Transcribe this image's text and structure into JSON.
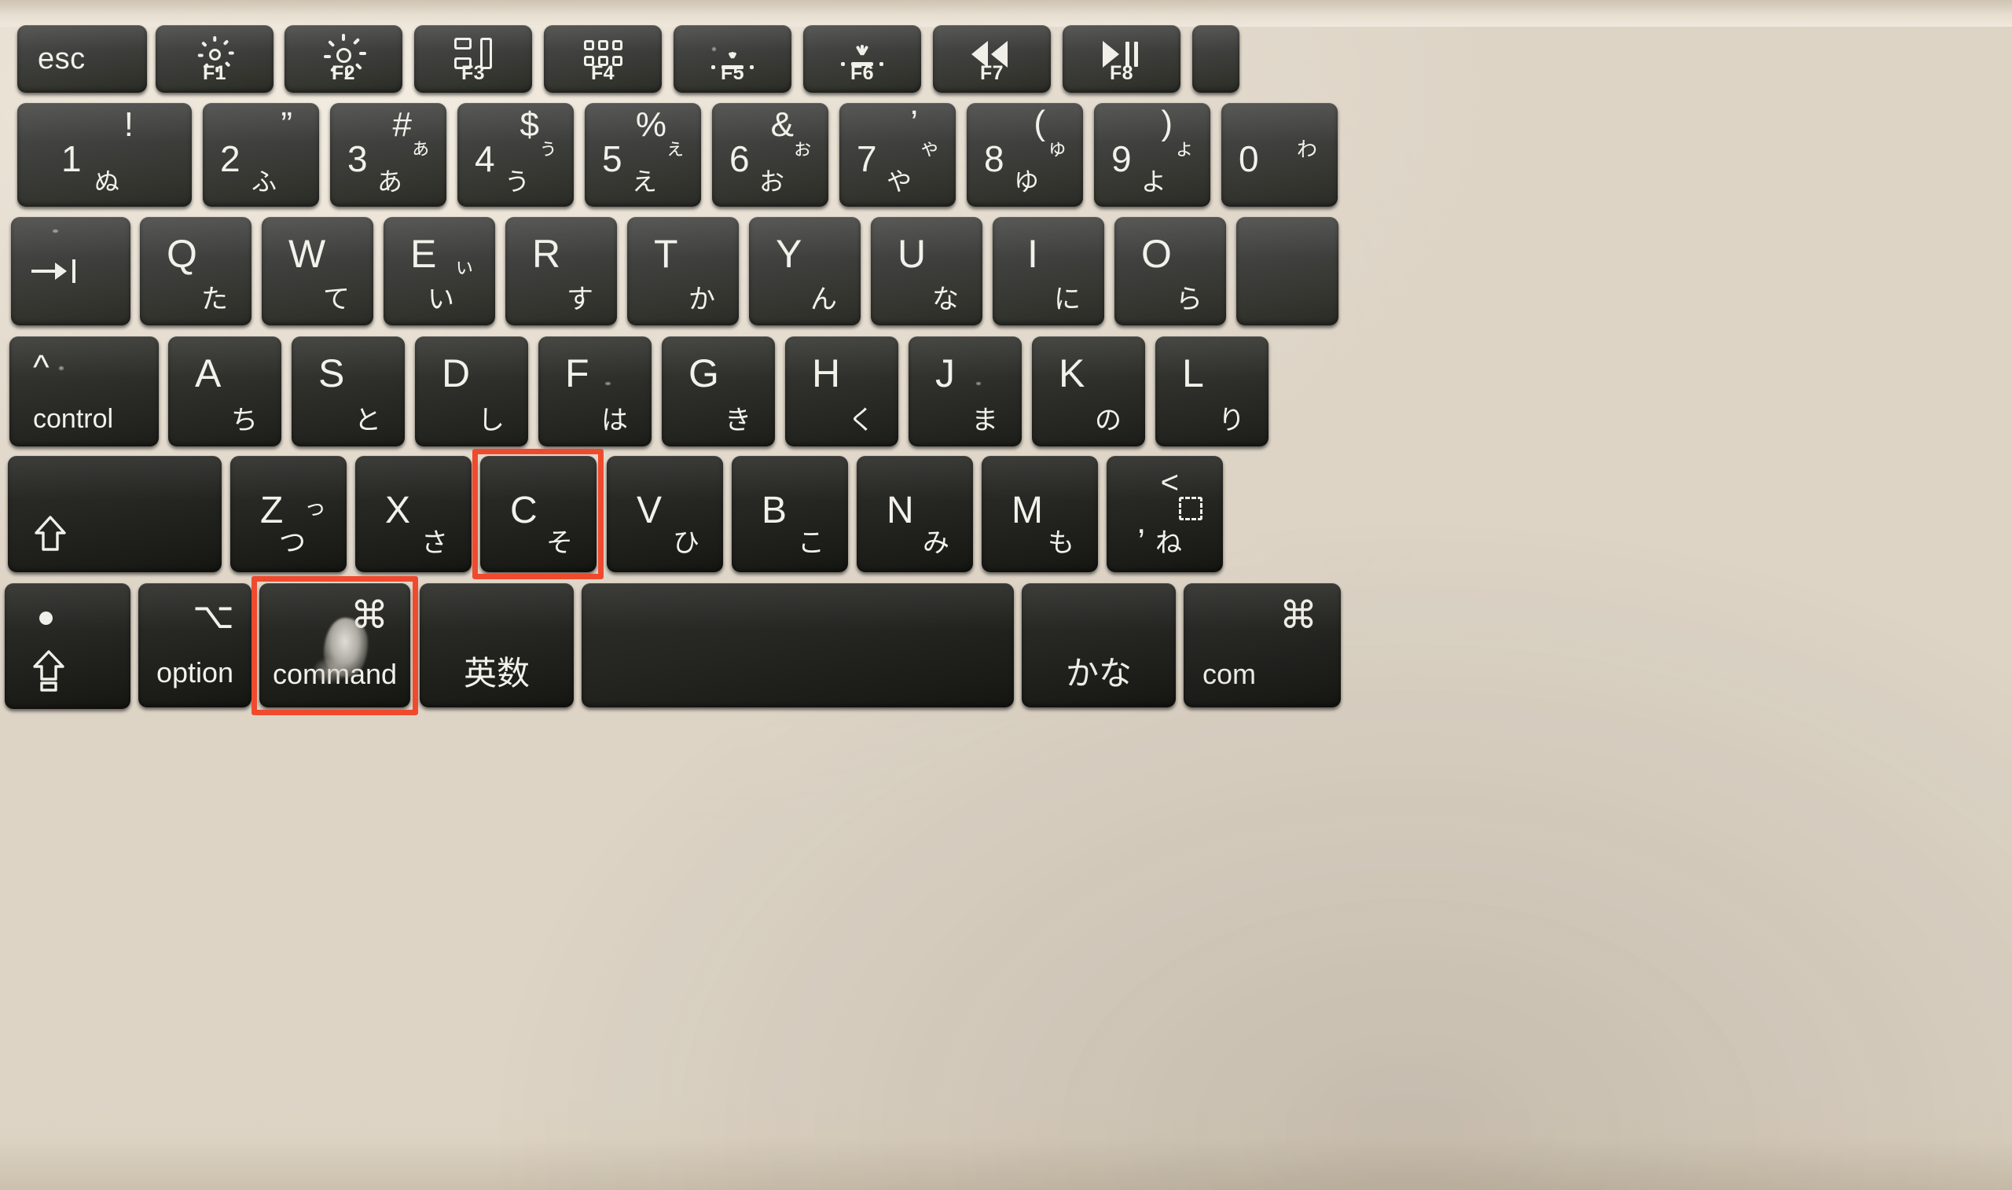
{
  "scene": {
    "subject": "apple-magic-keyboard-japanese-jis-layout",
    "description": "Close-up photograph of a Japanese JIS Apple Magic Keyboard with two keys outlined in red",
    "body_color": "#e4dbcd",
    "key_color": "#3a3b37",
    "legend_color": "#f2f1ea",
    "highlight_color": "#f04a2e"
  },
  "annotations": {
    "highlight_label": "red-outline",
    "boxes": [
      {
        "target": "c-key",
        "note": "C key outlined in red"
      },
      {
        "target": "command-key",
        "note": "command key outlined in red"
      }
    ]
  },
  "rows": {
    "function_row": [
      {
        "name": "esc",
        "label": "esc",
        "icon": null,
        "fn": null
      },
      {
        "name": "f1",
        "label": null,
        "icon": "brightness-down-icon",
        "fn": "F1"
      },
      {
        "name": "f2",
        "label": null,
        "icon": "brightness-up-icon",
        "fn": "F2"
      },
      {
        "name": "f3",
        "label": null,
        "icon": "mission-control-icon",
        "fn": "F3"
      },
      {
        "name": "f4",
        "label": null,
        "icon": "launchpad-icon",
        "fn": "F4"
      },
      {
        "name": "f5",
        "label": null,
        "icon": "keyboard-backlight-down-icon",
        "fn": "F5"
      },
      {
        "name": "f6",
        "label": null,
        "icon": "keyboard-backlight-up-icon",
        "fn": "F6"
      },
      {
        "name": "f7",
        "label": null,
        "icon": "rewind-icon",
        "fn": "F7"
      },
      {
        "name": "f8",
        "label": null,
        "icon": "play-pause-icon",
        "fn": "F8"
      }
    ],
    "number_row": [
      {
        "name": "key-1",
        "digit": "1",
        "symbol": "!",
        "kana_top": null,
        "kana_bottom": "ぬ"
      },
      {
        "name": "key-2",
        "digit": "2",
        "symbol": "”",
        "kana_top": null,
        "kana_bottom": "ふ"
      },
      {
        "name": "key-3",
        "digit": "3",
        "symbol": "#",
        "kana_top": "ぁ",
        "kana_bottom": "あ"
      },
      {
        "name": "key-4",
        "digit": "4",
        "symbol": "$",
        "kana_top": "ぅ",
        "kana_bottom": "う"
      },
      {
        "name": "key-5",
        "digit": "5",
        "symbol": "%",
        "kana_top": "ぇ",
        "kana_bottom": "え"
      },
      {
        "name": "key-6",
        "digit": "6",
        "symbol": "&",
        "kana_top": "ぉ",
        "kana_bottom": "お"
      },
      {
        "name": "key-7",
        "digit": "7",
        "symbol": "’",
        "kana_top": "ゃ",
        "kana_bottom": "や"
      },
      {
        "name": "key-8",
        "digit": "8",
        "symbol": "(",
        "kana_top": "ゅ",
        "kana_bottom": "ゆ"
      },
      {
        "name": "key-9",
        "digit": "9",
        "symbol": ")",
        "kana_top": "ょ",
        "kana_bottom": "よ"
      },
      {
        "name": "key-0",
        "digit": "0",
        "symbol": null,
        "kana_top": "わ",
        "kana_bottom": null
      }
    ],
    "top_alpha_row": [
      {
        "name": "tab-key",
        "label": null,
        "icon": "tab-icon",
        "kana": null
      },
      {
        "name": "key-q",
        "label": "Q",
        "kana": "た"
      },
      {
        "name": "key-w",
        "label": "W",
        "kana": "て"
      },
      {
        "name": "key-e",
        "label": "E",
        "kana": "い",
        "kana_small": "ぃ"
      },
      {
        "name": "key-r",
        "label": "R",
        "kana": "す"
      },
      {
        "name": "key-t",
        "label": "T",
        "kana": "か"
      },
      {
        "name": "key-y",
        "label": "Y",
        "kana": "ん"
      },
      {
        "name": "key-u",
        "label": "U",
        "kana": "な"
      },
      {
        "name": "key-i",
        "label": "I",
        "kana": "に"
      },
      {
        "name": "key-o",
        "label": "O",
        "kana": "ら"
      }
    ],
    "home_row": [
      {
        "name": "control-key",
        "label": "control",
        "icon": "caret-icon"
      },
      {
        "name": "key-a",
        "label": "A",
        "kana": "ち"
      },
      {
        "name": "key-s",
        "label": "S",
        "kana": "と"
      },
      {
        "name": "key-d",
        "label": "D",
        "kana": "し"
      },
      {
        "name": "key-f",
        "label": "F",
        "kana": "は"
      },
      {
        "name": "key-g",
        "label": "G",
        "kana": "き"
      },
      {
        "name": "key-h",
        "label": "H",
        "kana": "く"
      },
      {
        "name": "key-j",
        "label": "J",
        "kana": "ま"
      },
      {
        "name": "key-k",
        "label": "K",
        "kana": "の"
      },
      {
        "name": "key-l",
        "label": "L",
        "kana": "り"
      }
    ],
    "bottom_alpha_row": [
      {
        "name": "shift-key",
        "label": null,
        "icon": "shift-icon"
      },
      {
        "name": "key-z",
        "label": "Z",
        "kana": "つ",
        "kana_small": "っ"
      },
      {
        "name": "key-x",
        "label": "X",
        "kana": "さ"
      },
      {
        "name": "key-c",
        "label": "C",
        "kana": "そ",
        "highlighted": true
      },
      {
        "name": "key-v",
        "label": "V",
        "kana": "ひ"
      },
      {
        "name": "key-b",
        "label": "B",
        "kana": "こ"
      },
      {
        "name": "key-n",
        "label": "N",
        "kana": "み"
      },
      {
        "name": "key-m",
        "label": "M",
        "kana": "も"
      },
      {
        "name": "key-comma",
        "label": ",",
        "symbol": "<",
        "kana": "ね",
        "icon": "dotted-square-icon"
      }
    ],
    "modifier_row": [
      {
        "name": "caps-lock-key",
        "label": null,
        "icon": "caps-lock-icon",
        "indicator": "caps-lock-indicator-dot"
      },
      {
        "name": "option-key",
        "label": "option",
        "icon": "option-glyph-icon",
        "glyph": "⌥"
      },
      {
        "name": "command-key-left",
        "label": "command",
        "icon": "command-glyph-icon",
        "glyph": "⌘",
        "highlighted": true
      },
      {
        "name": "eisu-key",
        "label": "英数"
      },
      {
        "name": "space-key",
        "label": null
      },
      {
        "name": "kana-key",
        "label": "かな"
      },
      {
        "name": "command-key-right",
        "label": "com",
        "icon": "command-glyph-icon",
        "glyph": "⌘"
      }
    ]
  }
}
